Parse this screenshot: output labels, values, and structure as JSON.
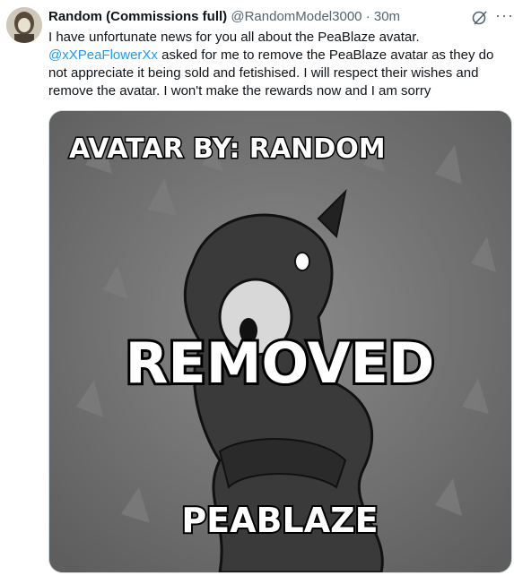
{
  "tweet": {
    "display_name": "Random (Commissions full)",
    "handle": "@RandomModel3000",
    "separator": "·",
    "time": "30m",
    "text_line1": "I have unfortunate news for you all about the PeaBlaze avatar.",
    "mention": "@xXPeaFlowerXx",
    "text_rest": " asked for me to remove the PeaBlaze avatar as they do not appreciate it being sold and fetishised. I will respect their wishes and remove the avatar. I won't make the rewards now and I am sorry",
    "more_label": "···"
  },
  "media": {
    "top_caption": "AVATAR BY: RANDOM",
    "center_caption": "REMOVED",
    "bottom_caption": "PEABLAZE"
  },
  "icons": {
    "grok": "grok-icon",
    "more": "more-icon"
  },
  "colors": {
    "link": "#1d9bf0",
    "secondary_text": "#536471",
    "primary_text": "#0f1419"
  }
}
